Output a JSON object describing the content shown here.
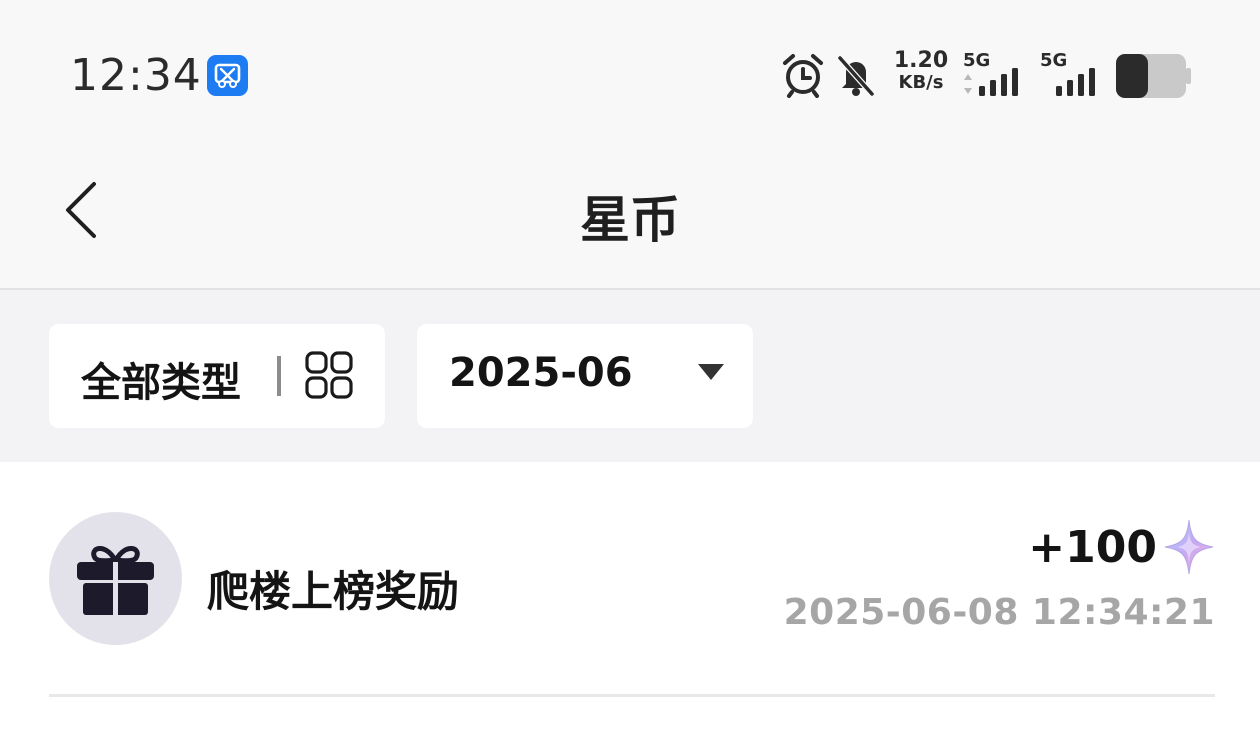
{
  "status_bar": {
    "time": "12:34",
    "net_speed_value": "1.20",
    "net_speed_unit": "KB/s",
    "sim1_label": "5G",
    "sim2_label": "5G",
    "battery_level": 0.45
  },
  "nav": {
    "title": "星币"
  },
  "filters": {
    "type_label": "全部类型",
    "date_value": "2025-06"
  },
  "records": [
    {
      "title": "爬楼上榜奖励",
      "amount": "+100",
      "timestamp": "2025-06-08 12:34:21",
      "icon": "gift-icon",
      "currency_icon": "star-icon"
    }
  ],
  "colors": {
    "accent_blue": "#1e7cf2",
    "amount_color": "#141414",
    "timestamp_color": "#a6a6a6",
    "avatar_bg": "#e3e2ea"
  }
}
